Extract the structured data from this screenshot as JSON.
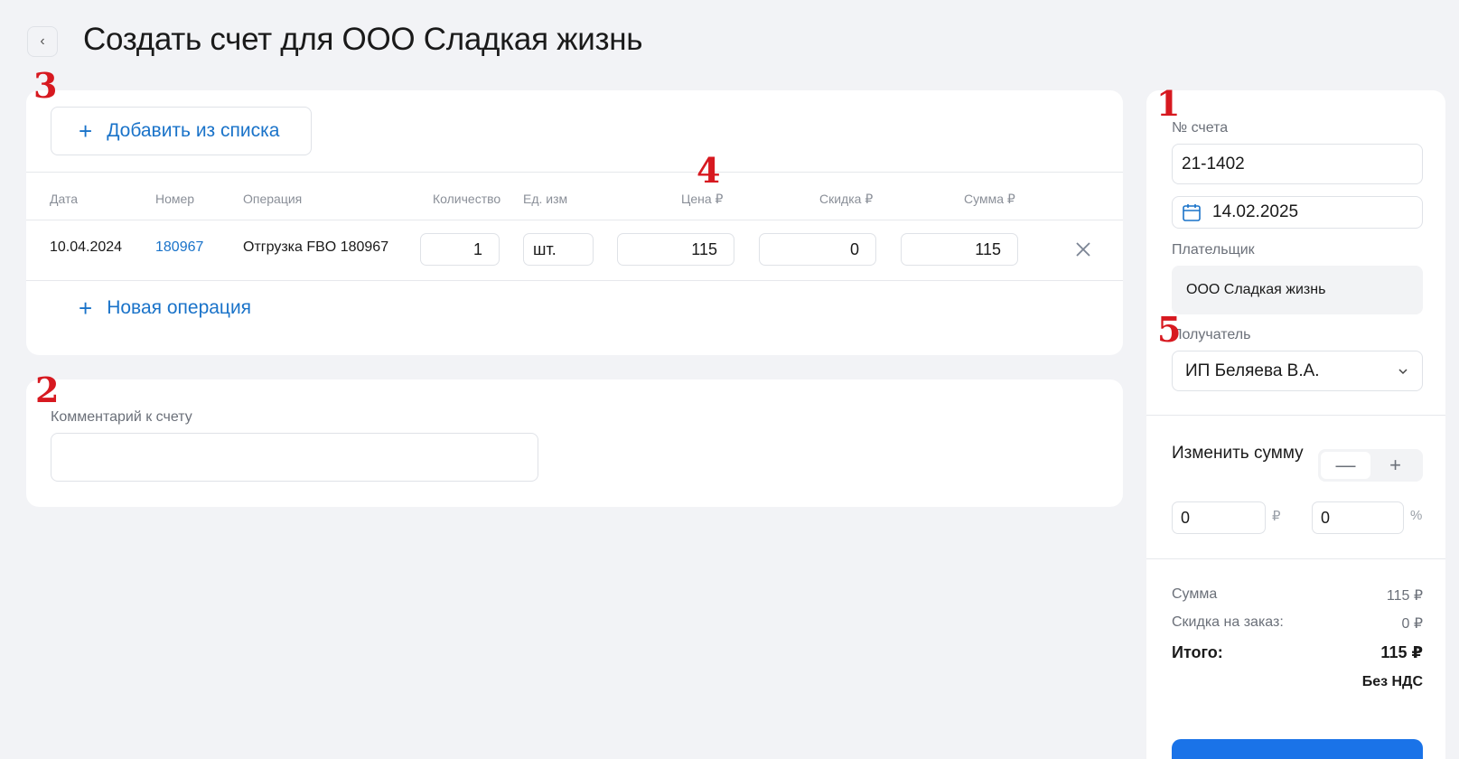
{
  "page": {
    "title": "Создать счет для ООО Сладкая жизнь",
    "back_icon": "chevron-left-icon"
  },
  "markers": [
    "1",
    "2",
    "3",
    "4",
    "5"
  ],
  "operations": {
    "add_from_list_label": "Добавить из списка",
    "new_operation_label": "Новая операция",
    "columns": [
      "Дата",
      "Номер",
      "Операция",
      "Количество",
      "Ед. изм",
      "Цена ₽",
      "Скидка ₽",
      "Сумма ₽"
    ],
    "rows": [
      {
        "date": "10.04.2024",
        "number": "180967",
        "operation": "Отгрузка FBO 180967",
        "quantity": "1",
        "unit": "шт.",
        "price": "115",
        "discount": "0",
        "sum": "115"
      }
    ]
  },
  "comment": {
    "label": "Комментарий к счету",
    "value": ""
  },
  "sidebar": {
    "invoice_number_label": "№ счета",
    "invoice_number": "21-1402",
    "date": "14.02.2025",
    "payer_label": "Плательщик",
    "payer": "ООО Сладкая жизнь",
    "recipient_label": "Получатель",
    "recipient": "ИП Беляева В.А.",
    "change_sum_label": "Изменить сумму",
    "minus": "—",
    "plus": "+",
    "amount_rub": "0",
    "amount_pct": "0",
    "rub_unit": "₽",
    "pct_unit": "%",
    "sum_label": "Сумма",
    "sum_value": "115 ₽",
    "discount_label": "Скидка на заказ:",
    "discount_value": "0 ₽",
    "total_label": "Итого:",
    "total_value": "115 ₽",
    "vat_note": "Без НДС"
  },
  "colors": {
    "accent": "#1a73c9",
    "primary_button": "#1a73e8",
    "marker": "#d71920",
    "background": "#f2f3f6"
  }
}
